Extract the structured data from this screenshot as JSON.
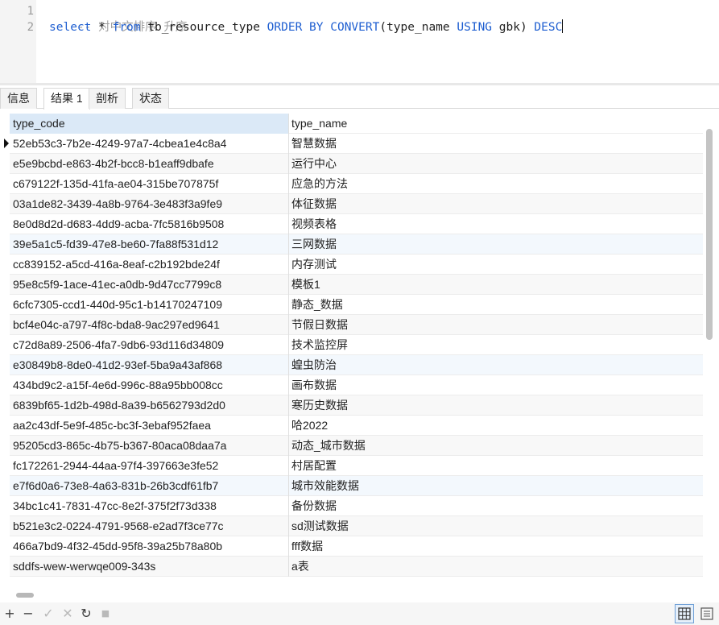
{
  "editor": {
    "line_numbers": [
      "1",
      "2"
    ],
    "line1": {
      "comment": "-- 对中文排序 升序"
    },
    "line2": {
      "t1": "select",
      "t2": " * ",
      "t3": "from",
      "t4": " tb_resource_type ",
      "t5": "ORDER BY",
      "t6": " ",
      "t7": "CONVERT",
      "t8": "(type_name ",
      "t9": "USING",
      "t10": " gbk) ",
      "t11": "DESC"
    }
  },
  "tabs": [
    {
      "label": "信息"
    },
    {
      "label": "结果 1"
    },
    {
      "label": "剖析"
    },
    {
      "label": "状态"
    }
  ],
  "grid": {
    "columns": [
      "type_code",
      "type_name"
    ],
    "rows": [
      [
        "52eb53c3-7b2e-4249-97a7-4cbea1e4c8a4",
        "智慧数据"
      ],
      [
        "e5e9bcbd-e863-4b2f-bcc8-b1eaff9dbafe",
        "运行中心"
      ],
      [
        "c679122f-135d-41fa-ae04-315be707875f",
        "应急的方法"
      ],
      [
        "03a1de82-3439-4a8b-9764-3e483f3a9fe9",
        "体征数据"
      ],
      [
        "8e0d8d2d-d683-4dd9-acba-7fc5816b9508",
        "视频表格"
      ],
      [
        "39e5a1c5-fd39-47e8-be60-7fa88f531d12",
        "三网数据"
      ],
      [
        "cc839152-a5cd-416a-8eaf-c2b192bde24f",
        "内存测试"
      ],
      [
        "95e8c5f9-1ace-41ec-a0db-9d47cc7799c8",
        "模板1"
      ],
      [
        "6cfc7305-ccd1-440d-95c1-b14170247109",
        "静态_数据"
      ],
      [
        "bcf4e04c-a797-4f8c-bda8-9ac297ed9641",
        "节假日数据"
      ],
      [
        "c72d8a89-2506-4fa7-9db6-93d116d34809",
        "技术监控屏"
      ],
      [
        "e30849b8-8de0-41d2-93ef-5ba9a43af868",
        "蝗虫防治"
      ],
      [
        "434bd9c2-a15f-4e6d-996c-88a95bb008cc",
        "画布数据"
      ],
      [
        "6839bf65-1d2b-498d-8a39-b6562793d2d0",
        "寒历史数据"
      ],
      [
        "aa2c43df-5e9f-485c-bc3f-3ebaf952faea",
        "哈2022"
      ],
      [
        "95205cd3-865c-4b75-b367-80aca08daa7a",
        "动态_城市数据"
      ],
      [
        "fc172261-2944-44aa-97f4-397663e3fe52",
        "村居配置"
      ],
      [
        "e7f6d0a6-73e8-4a63-831b-26b3cdf61fb7",
        "城市效能数据"
      ],
      [
        "34bc1c41-7831-47cc-8e2f-375f2f73d338",
        "备份数据"
      ],
      [
        "b521e3c2-0224-4791-9568-e2ad7f3ce77c",
        "sd测试数据"
      ],
      [
        "466a7bd9-4f32-45dd-95f8-39a25b78a80b",
        "fff数据"
      ],
      [
        "sddfs-wew-werwqe009-343s",
        "a表"
      ]
    ]
  },
  "toolbar": {
    "add_glyph": "+",
    "remove_glyph": "−",
    "apply_glyph": "✓",
    "discard_glyph": "✕",
    "refresh_glyph": "↻",
    "stop_glyph": "■"
  },
  "colors": {
    "keyword": "#1f5fd1",
    "comment": "#a0a0a0",
    "header_highlight": "#dbe9f7",
    "active_view_border": "#6e9fd6"
  }
}
